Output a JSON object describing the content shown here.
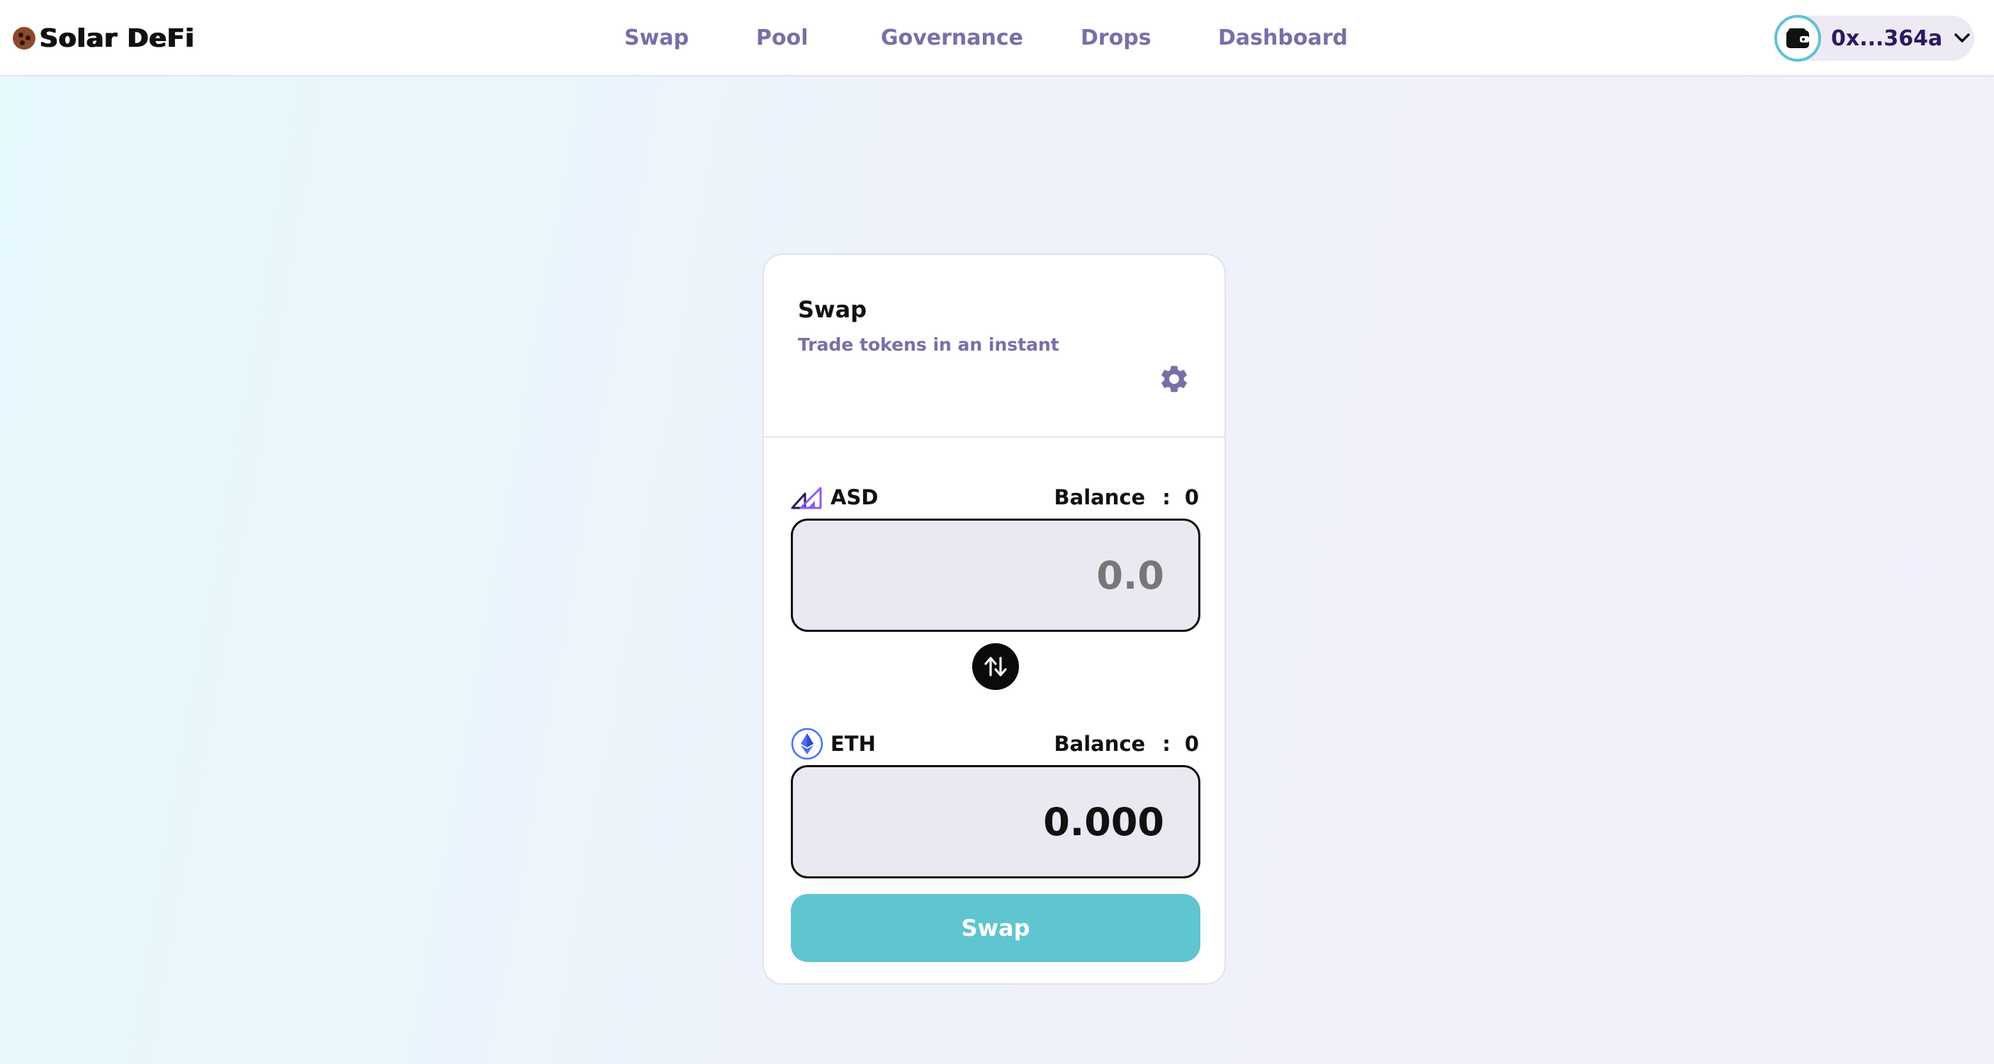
{
  "app": {
    "brand": "Solar DeFi"
  },
  "nav": {
    "items": [
      {
        "label": "Swap"
      },
      {
        "label": "Pool"
      },
      {
        "label": "Governance"
      },
      {
        "label": "Drops"
      },
      {
        "label": "Dashboard"
      }
    ]
  },
  "wallet": {
    "address": "0x...364a",
    "icon": "wallet-icon"
  },
  "swap": {
    "title": "Swap",
    "subtitle": "Trade tokens in an instant",
    "settings_icon": "gear-icon",
    "from": {
      "symbol": "ASD",
      "balance_label": "Balance",
      "balance_sep": ":",
      "balance_value": "0",
      "amount_placeholder": "0.0",
      "amount_value": ""
    },
    "to": {
      "symbol": "ETH",
      "balance_label": "Balance",
      "balance_sep": ":",
      "balance_value": "0",
      "amount_placeholder": "0.0",
      "amount_value": "0.000"
    },
    "flip_icon": "swap-arrows-icon",
    "submit_label": "Swap"
  },
  "colors": {
    "accent": "#5fc5d0",
    "nav_text": "#7a6ea8",
    "input_bg": "#ebe8f2"
  }
}
